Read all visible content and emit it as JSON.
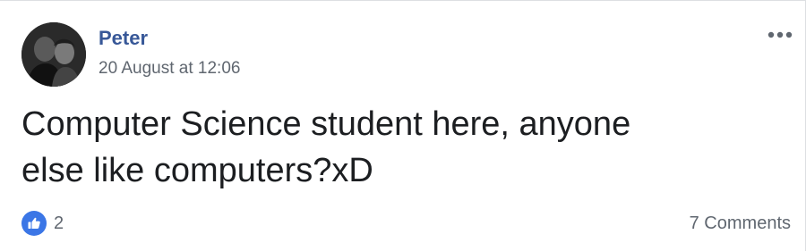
{
  "post": {
    "author": "Peter",
    "timestamp": "20 August at 12:06",
    "text_line_1": "Computer Science student here, anyone",
    "text_line_2": "else like computers?xD",
    "likes": "2",
    "comments": "7 Comments"
  },
  "icons": {
    "avatar": "profile-photo",
    "more": "more-options-icon",
    "like": "like-thumbs-up-icon"
  },
  "colors": {
    "author_link": "#385898",
    "meta_text": "#606770",
    "body_text": "#1c1e21",
    "like_badge": "#3b76e6"
  }
}
